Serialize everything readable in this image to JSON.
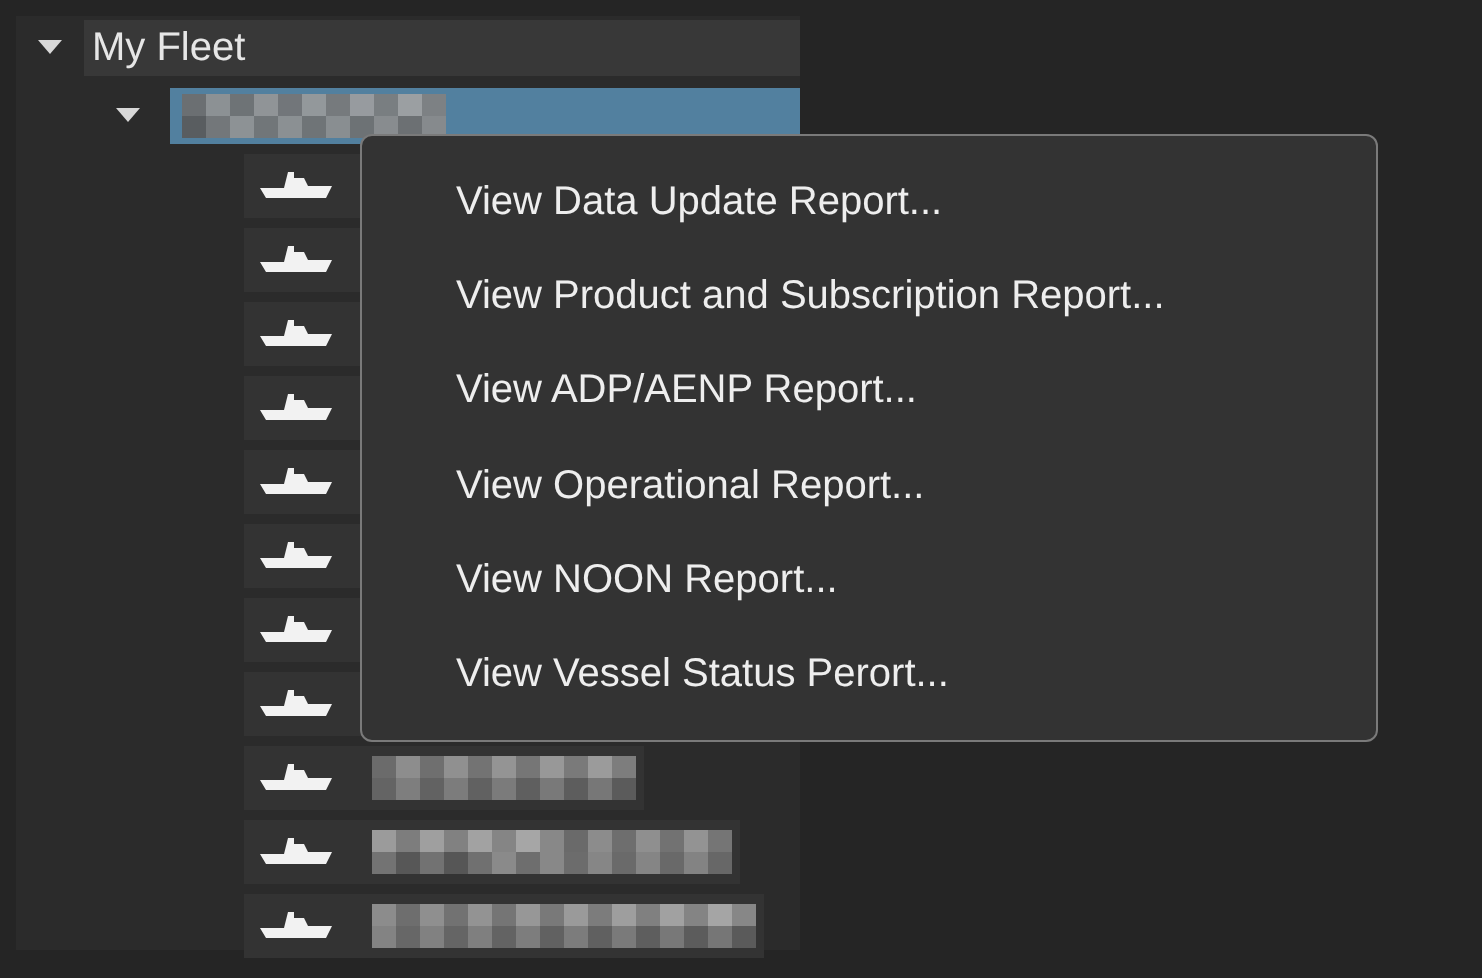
{
  "tree": {
    "label": "My Fleet",
    "expanded": true,
    "group": {
      "expanded": true,
      "selected": true,
      "label_blurred": true,
      "vessels": [
        {
          "kind": "covered"
        },
        {
          "kind": "covered"
        },
        {
          "kind": "covered"
        },
        {
          "kind": "covered"
        },
        {
          "kind": "covered"
        },
        {
          "kind": "covered"
        },
        {
          "kind": "covered"
        },
        {
          "kind": "covered"
        },
        {
          "kind": "redacted"
        },
        {
          "kind": "redacted"
        },
        {
          "kind": "redacted"
        }
      ]
    }
  },
  "context_menu": {
    "items": [
      {
        "label": "View Data Update Report..."
      },
      {
        "label": "View Product and Subscription Report..."
      },
      {
        "label": "View ADP/AENP Report..."
      },
      {
        "label": "View Operational Report..."
      },
      {
        "label": "View NOON Report..."
      },
      {
        "label": "View Vessel Status Perort..."
      }
    ]
  }
}
